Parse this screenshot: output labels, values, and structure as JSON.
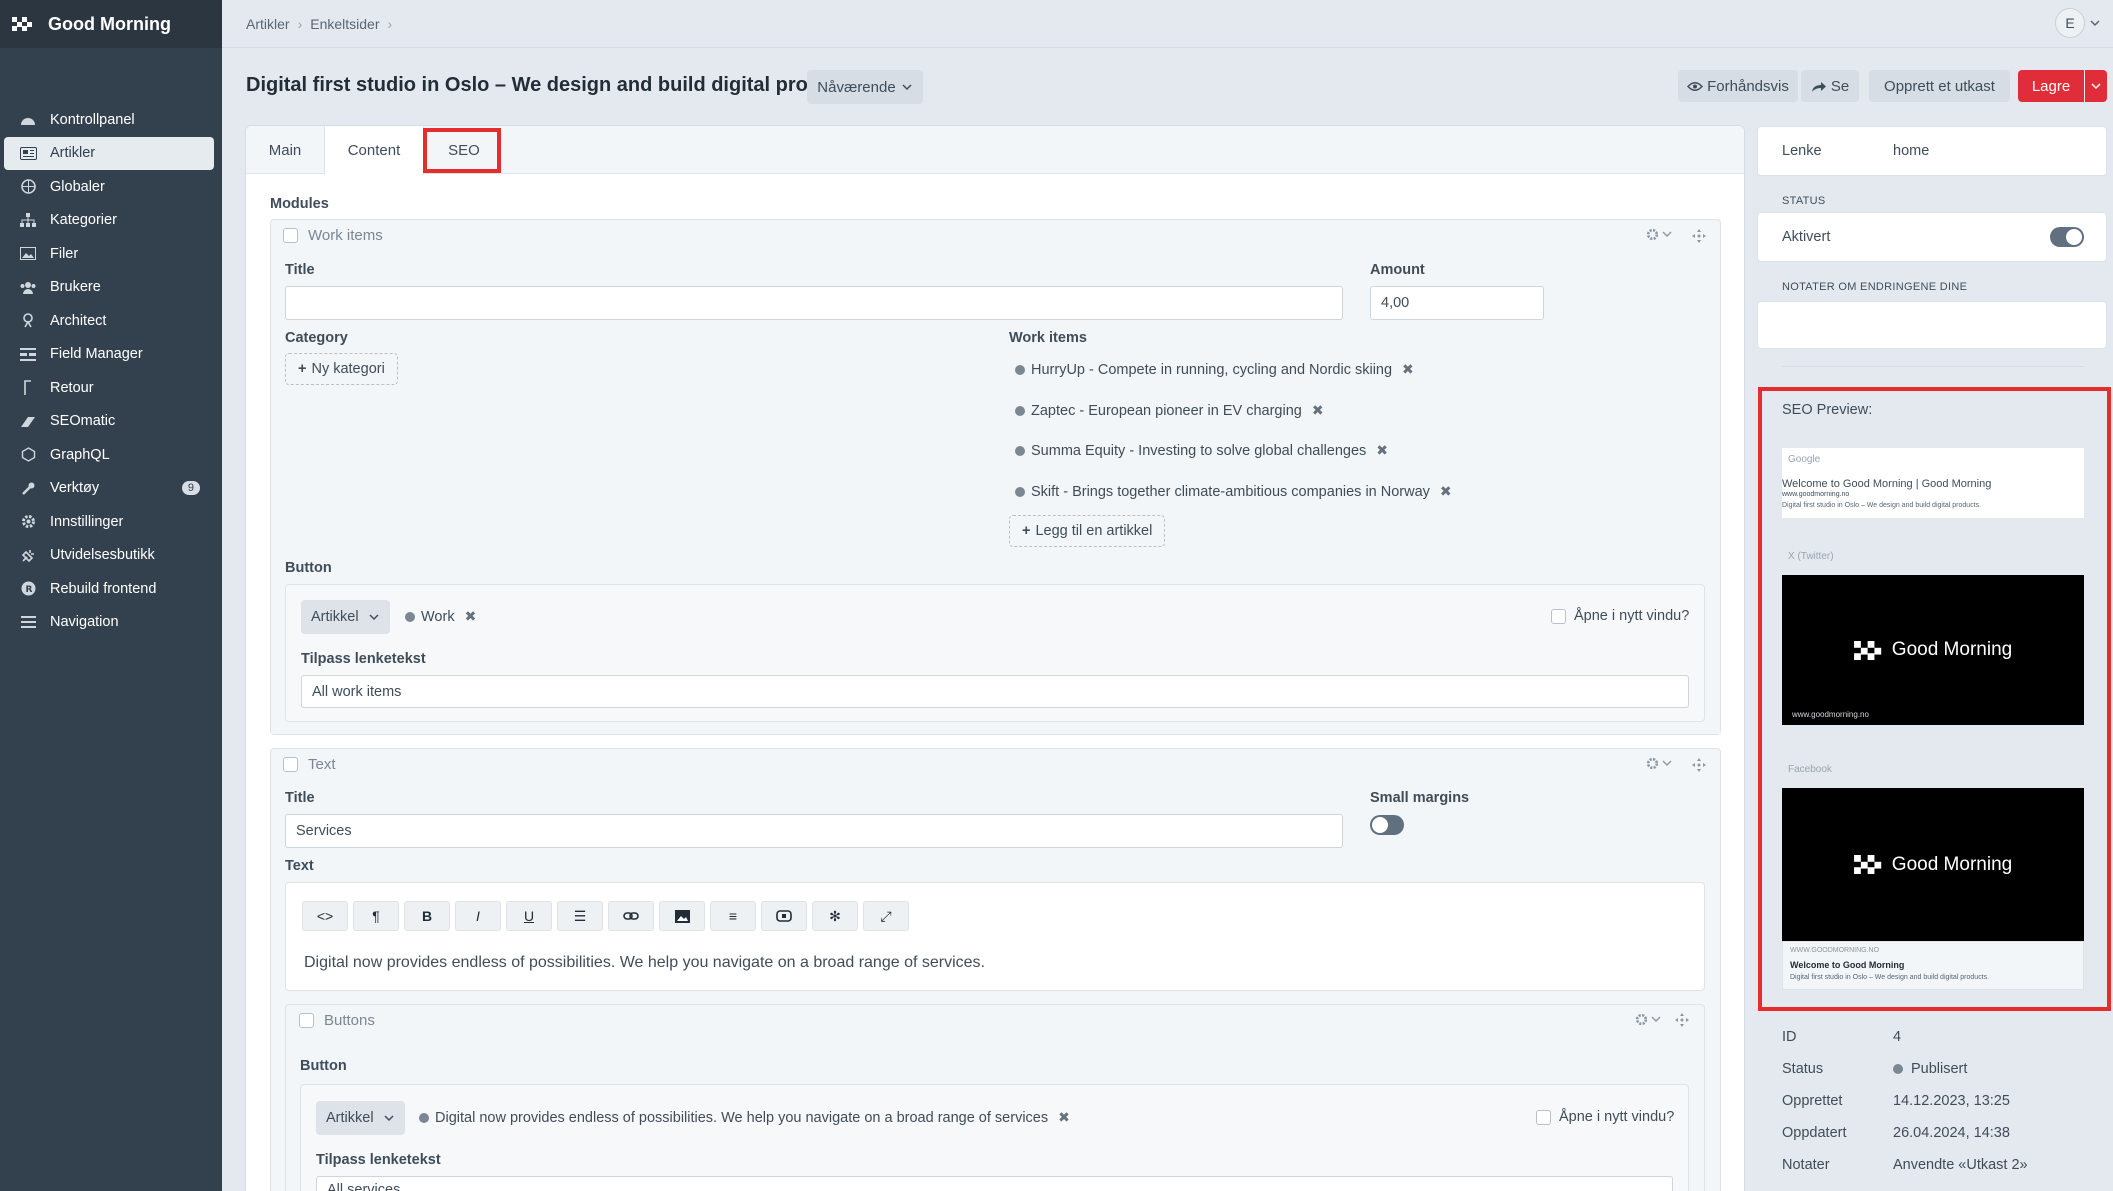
{
  "brand": {
    "name": "Good Morning"
  },
  "sidebar": {
    "items": [
      {
        "label": "Kontrollpanel",
        "icon": "dashboard-icon"
      },
      {
        "label": "Artikler",
        "icon": "newspaper-icon",
        "active": true
      },
      {
        "label": "Globaler",
        "icon": "globe-icon"
      },
      {
        "label": "Kategorier",
        "icon": "sitemap-icon"
      },
      {
        "label": "Filer",
        "icon": "image-icon"
      },
      {
        "label": "Brukere",
        "icon": "users-icon"
      },
      {
        "label": "Architect",
        "icon": "architect-icon"
      },
      {
        "label": "Field Manager",
        "icon": "field-manager-icon"
      },
      {
        "label": "Retour",
        "icon": "retour-icon"
      },
      {
        "label": "SEOmatic",
        "icon": "seomatic-icon"
      },
      {
        "label": "GraphQL",
        "icon": "graphql-icon"
      },
      {
        "label": "Verktøy",
        "icon": "wrench-icon",
        "badge": "9"
      },
      {
        "label": "Innstillinger",
        "icon": "gear-icon"
      },
      {
        "label": "Utvidelsesbutikk",
        "icon": "plug-icon"
      },
      {
        "label": "Rebuild frontend",
        "icon": "rebuild-icon"
      },
      {
        "label": "Navigation",
        "icon": "menu-icon"
      }
    ]
  },
  "breadcrumb": [
    "Artikler",
    "Enkeltsider"
  ],
  "user": {
    "initial": "E"
  },
  "header": {
    "title": "Digital first studio in Oslo – We design and build digital products.",
    "revision": "Nåværende",
    "preview": "Forhåndsvis",
    "view": "Se",
    "create_draft": "Opprett et utkast",
    "save": "Lagre"
  },
  "tabs": [
    {
      "label": "Main"
    },
    {
      "label": "Content",
      "active": true
    },
    {
      "label": "SEO"
    }
  ],
  "modules_label": "Modules",
  "work_block": {
    "name": "Work items",
    "title_label": "Title",
    "title_value": "",
    "amount_label": "Amount",
    "amount_value": "4,00",
    "category_label": "Category",
    "new_category": "Ny kategori",
    "work_items_label": "Work items",
    "entries": [
      "HurryUp - Compete in running, cycling and Nordic skiing",
      "Zaptec - European pioneer in EV charging",
      "Summa Equity - Investing to solve global challenges",
      "Skift - Brings together climate-ambitious companies in Norway"
    ],
    "add_article": "Legg til en artikkel",
    "button_label": "Button",
    "link_type": "Artikkel",
    "link_entry": "Work",
    "new_window": "Åpne i nytt vindu?",
    "custom_text_label": "Tilpass lenketekst",
    "custom_text_value": "All work items"
  },
  "text_block": {
    "name": "Text",
    "title_label": "Title",
    "title_value": "Services",
    "small_margins_label": "Small margins",
    "text_label": "Text",
    "body": "Digital now provides endless of possibilities. We help you navigate on a broad range of services.",
    "toolbar": [
      "code-icon",
      "paragraph-icon",
      "bold-icon",
      "italic-icon",
      "underline-icon",
      "list-icon",
      "link-icon",
      "image-icon",
      "align-icon",
      "embed-icon",
      "asterisk-icon",
      "fullscreen-icon"
    ]
  },
  "buttons_block": {
    "name": "Buttons",
    "button_label": "Button",
    "link_type": "Artikkel",
    "link_entry": "Digital now provides endless of possibilities. We help you navigate on a broad range of services",
    "new_window": "Åpne i nytt vindu?",
    "custom_text_label": "Tilpass lenketekst",
    "custom_text_value": "All services"
  },
  "right": {
    "link_label": "Lenke",
    "link_value": "home",
    "status_heading": "STATUS",
    "enabled_label": "Aktivert",
    "notes_heading": "NOTATER OM ENDRINGENE DINE",
    "seo_preview_label": "SEO Preview:",
    "google": {
      "label": "Google",
      "title": "Welcome to Good Morning | Good Morning",
      "url": "www.goodmorning.no",
      "desc": "Digital first studio in Oslo – We design and build digital products."
    },
    "twitter": {
      "label": "X (Twitter)",
      "card_text": "Good Morning",
      "url": "www.goodmorning.no"
    },
    "facebook": {
      "label": "Facebook",
      "card_text": "Good Morning",
      "domain": "WWW.GOODMORNING.NO",
      "title": "Welcome to Good Morning",
      "desc": "Digital first studio in Oslo – We design and build digital products."
    },
    "meta": [
      {
        "k": "ID",
        "v": "4"
      },
      {
        "k": "Status",
        "v": "Publisert"
      },
      {
        "k": "Opprettet",
        "v": "14.12.2023, 13:25"
      },
      {
        "k": "Oppdatert",
        "v": "26.04.2024, 14:38"
      },
      {
        "k": "Notater",
        "v": "Anvendte «Utkast 2»"
      }
    ]
  },
  "colors": {
    "sidebar": "#33404d",
    "accent": "#e12d39",
    "highlight": "#e52d2d"
  }
}
